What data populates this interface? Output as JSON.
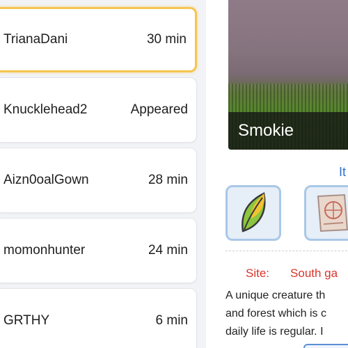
{
  "list": {
    "rows": [
      {
        "name": "TrianaDani",
        "time": "30 min"
      },
      {
        "name": "Knucklehead2",
        "time": "Appeared"
      },
      {
        "name": "Aizn0oalGown",
        "time": "28 min"
      },
      {
        "name": "momonhunter",
        "time": "24 min"
      },
      {
        "name": "GRTHY",
        "time": "6 min"
      }
    ],
    "selected_index": 0
  },
  "detail": {
    "photo_caption": "Smokie",
    "items_link": "It",
    "item_icons": [
      "leaf-icon",
      "map-scroll-icon"
    ],
    "site_label": "Site:",
    "site_value": "South ga",
    "description_lines": [
      "A unique creature th",
      "and forest which is c",
      "daily life is regular. I"
    ]
  },
  "colors": {
    "selected_border": "#f6c451",
    "link": "#2e6fd1",
    "site_text": "#d9342b",
    "slot_border": "#a9c8e8"
  }
}
